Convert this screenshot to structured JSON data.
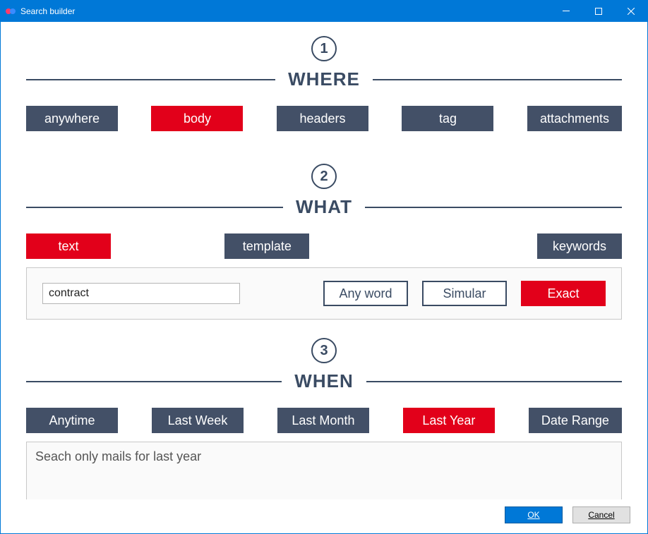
{
  "window": {
    "title": "Search builder"
  },
  "steps": {
    "where": {
      "number": "1",
      "title": "WHERE",
      "options": [
        "anywhere",
        "body",
        "headers",
        "tag",
        "attachments"
      ],
      "selected": 1
    },
    "what": {
      "number": "2",
      "title": "WHAT",
      "options": [
        "text",
        "template",
        "keywords"
      ],
      "selected": 0,
      "input_value": "contract",
      "match_options": [
        "Any word",
        "Simular",
        "Exact"
      ],
      "match_selected": 2
    },
    "when": {
      "number": "3",
      "title": "WHEN",
      "options": [
        "Anytime",
        "Last Week",
        "Last Month",
        "Last Year",
        "Date Range"
      ],
      "selected": 3,
      "description": "Seach only mails for last year"
    }
  },
  "footer": {
    "ok_label": "OK",
    "cancel_label": "Cancel"
  },
  "colors": {
    "accent": "#0078d7",
    "pill": "#435067",
    "active": "#e2001a",
    "heading": "#3a4b63"
  }
}
